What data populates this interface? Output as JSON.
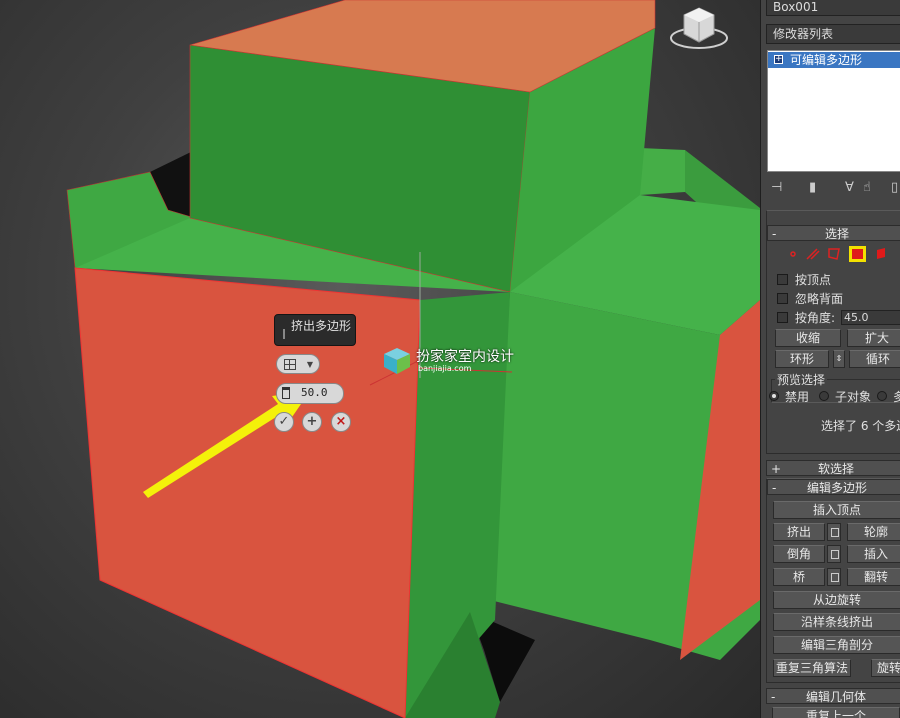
{
  "viewport": {
    "caddy": {
      "title": "挤出多边形",
      "height_value": "50.0",
      "ok_icon": "check-icon",
      "apply_icon": "plus-icon",
      "cancel_icon": "close-icon"
    },
    "watermark": {
      "text": "扮家家室内设计",
      "url": "banjiajia.com"
    }
  },
  "panel": {
    "object_name": "Box001",
    "modifier_list": "修改器列表",
    "stack_item": "可编辑多边形",
    "selection": {
      "header": "选择",
      "by_vertex": "按顶点",
      "ignore_backfacing": "忽略背面",
      "by_angle": "按角度:",
      "angle_value": "45.0",
      "shrink": "收缩",
      "grow": "扩大",
      "ring": "环形",
      "loop": "循环",
      "preview_group": "预览选择",
      "preview_off": "禁用",
      "preview_subobj": "子对象",
      "preview_multi": "多",
      "status": "选择了 6 个多边"
    },
    "soft_selection": {
      "header": "软选择"
    },
    "edit_polygons": {
      "header": "编辑多边形",
      "insert_vertex": "插入顶点",
      "extrude": "挤出",
      "outline": "轮廓",
      "bevel": "倒角",
      "inset": "插入",
      "bridge": "桥",
      "flip": "翻转",
      "hinge_from_edge": "从边旋转",
      "extrude_along_spline": "沿样条线挤出",
      "edit_triangulation": "编辑三角剖分",
      "retriangulate": "重复三角算法",
      "turn": "旋转"
    },
    "edit_geometry": {
      "header": "编辑几何体",
      "repeat_last": "重复上一个"
    },
    "colors": {
      "selected_face": "#d9543f",
      "top_face": "#d77a50",
      "green_face": "#3fa843",
      "highlight": "#3a76c2"
    }
  }
}
